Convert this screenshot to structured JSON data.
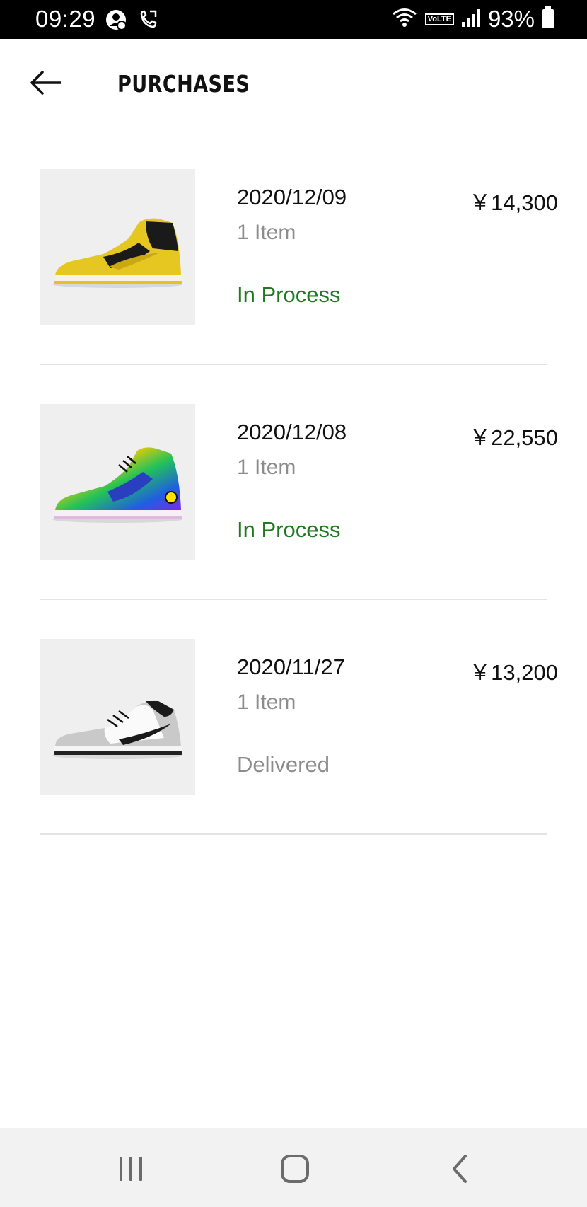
{
  "status_bar": {
    "time": "09:29",
    "battery": "93%",
    "volte": "VoLTE",
    "icons": [
      "account-sync-icon",
      "call-forward-icon",
      "wifi-icon",
      "volte-icon",
      "signal-icon",
      "battery-icon"
    ]
  },
  "header": {
    "title": "PURCHASES",
    "back_icon": "back-arrow-icon"
  },
  "orders": [
    {
      "date": "2020/12/09",
      "price": "￥14,300",
      "items": "1 Item",
      "status": "In Process",
      "status_color": "#1f7a1f",
      "image": "yellow-black-high-top-sneaker"
    },
    {
      "date": "2020/12/08",
      "price": "￥22,550",
      "items": "1 Item",
      "status": "In Process",
      "status_color": "#1f7a1f",
      "image": "tie-dye-high-top-sneaker"
    },
    {
      "date": "2020/11/27",
      "price": "￥13,200",
      "items": "1 Item",
      "status": "Delivered",
      "status_color": "#8c8c8c",
      "image": "grey-white-low-top-sneaker"
    }
  ],
  "nav_bar": {
    "icons": [
      "recent-apps-icon",
      "home-icon",
      "back-icon"
    ]
  }
}
